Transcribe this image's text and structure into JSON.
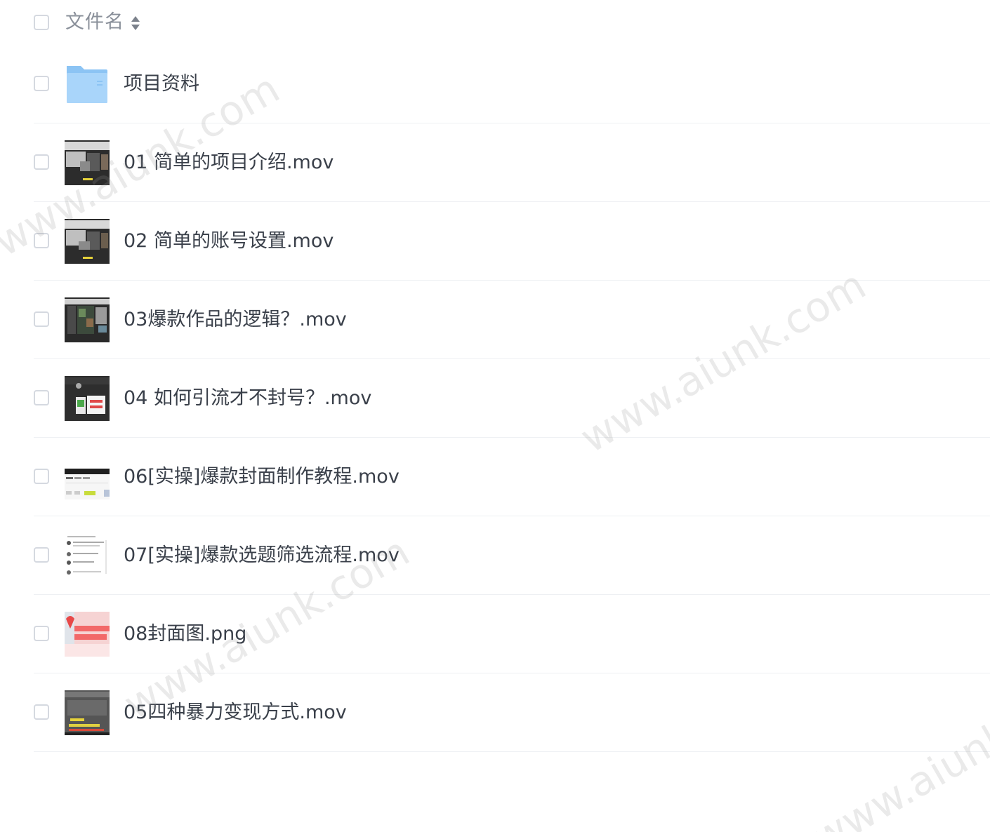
{
  "header": {
    "column_label": "文件名",
    "sort_icon": "sort-updown-icon"
  },
  "files": [
    {
      "name": "项目资料",
      "type": "folder",
      "icon": "folder-icon"
    },
    {
      "name": "01 简单的项目介绍.mov",
      "type": "video",
      "icon": "video-thumbnail"
    },
    {
      "name": "02 简单的账号设置.mov",
      "type": "video",
      "icon": "video-thumbnail"
    },
    {
      "name": "03爆款作品的逻辑？.mov",
      "type": "video",
      "icon": "video-thumbnail"
    },
    {
      "name": "04 如何引流才不封号？.mov",
      "type": "video",
      "icon": "video-thumbnail"
    },
    {
      "name": "06[实操]爆款封面制作教程.mov",
      "type": "video",
      "icon": "video-thumbnail"
    },
    {
      "name": "07[实操]爆款选题筛选流程.mov",
      "type": "video",
      "icon": "video-thumbnail"
    },
    {
      "name": "08封面图.png",
      "type": "image",
      "icon": "image-thumbnail"
    },
    {
      "name": "05四种暴力变现方式.mov",
      "type": "video",
      "icon": "video-thumbnail"
    }
  ],
  "watermarks": [
    "www.aiunk.com",
    "www.aiunk.com",
    "www.aiunk.com",
    "www.aiunk.com"
  ]
}
